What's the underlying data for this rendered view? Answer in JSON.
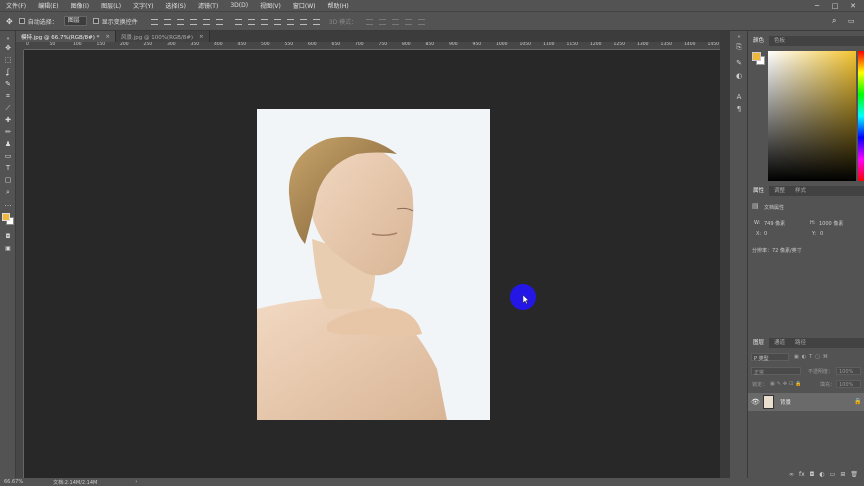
{
  "menubar": {
    "items": [
      "文件(F)",
      "编辑(E)",
      "图像(I)",
      "图层(L)",
      "文字(Y)",
      "选择(S)",
      "滤镜(T)",
      "3D(D)",
      "视图(V)",
      "窗口(W)",
      "帮助(H)"
    ],
    "window_controls": [
      "─",
      "□",
      "✕"
    ]
  },
  "options": {
    "auto_select_label": "自动选择：",
    "auto_select_value": "图层",
    "show_transform_label": "显示变换控件",
    "mode_3d_label": "3D 模式："
  },
  "tabs": [
    {
      "label": "模特.jpg @ 66.7%(RGB/8#) *",
      "close": "×"
    },
    {
      "label": "风景.jpg @ 100%(RGB/8#)",
      "close": "×"
    }
  ],
  "ruler": {
    "top_ticks": [
      "0",
      "50",
      "100",
      "150",
      "200",
      "250",
      "300",
      "350",
      "400",
      "450",
      "500",
      "550",
      "600",
      "650",
      "700",
      "750",
      "800",
      "850",
      "900",
      "950",
      "1000",
      "1050",
      "1100",
      "1150",
      "1200",
      "1250",
      "1300",
      "1350",
      "1400",
      "1450"
    ]
  },
  "panels": {
    "color_tabs": [
      "颜色",
      "色板"
    ],
    "properties_tabs": [
      "属性",
      "调整",
      "样式"
    ],
    "doc_props_title": "文档属性",
    "w_label": "W:",
    "w_value": "749 像素",
    "h_label": "H:",
    "h_value": "1000 像素",
    "x_label": "X:",
    "x_value": "0",
    "y_label": "Y:",
    "y_value": "0",
    "resolution": "分辨率：72 像素/英寸",
    "layers_tabs": [
      "图层",
      "通道",
      "路径"
    ],
    "layer_filter": "P 类型",
    "blend_mode": "正常",
    "opacity_label": "不透明度：",
    "opacity_value": "100%",
    "lock_label": "锁定：",
    "fill_label": "填充：",
    "fill_value": "100%",
    "layer_name": "背景",
    "fg_color": "#f0b73a",
    "bg_color": "#ffffff"
  },
  "status": {
    "zoom": "66.67%",
    "doc_info": "文档:2.14M/2.14M",
    "arrow": "›"
  }
}
